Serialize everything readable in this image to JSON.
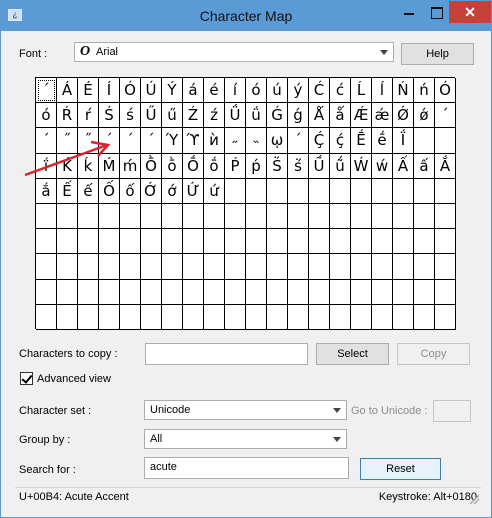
{
  "window": {
    "title": "Character Map",
    "app_icon_text": "¿",
    "close_glyph": "✕"
  },
  "font": {
    "label": "Font :",
    "icon_glyph": "O",
    "value": "Arial",
    "help_label": "Help"
  },
  "grid": {
    "rows": [
      [
        "´",
        "Á",
        "É",
        "Í",
        "Ó",
        "Ú",
        "Ý",
        "á",
        "é",
        "í",
        "ó",
        "ú",
        "ý",
        "Ć",
        "ć",
        "Ĺ",
        "ĺ",
        "Ń",
        "ń",
        "Ó"
      ],
      [
        "ó",
        "Ŕ",
        "ŕ",
        "Ś",
        "ś",
        "Ű",
        "ű",
        "Ź",
        "ź",
        "Ǘ",
        "ǘ",
        "Ǵ",
        "ǵ",
        "Ǻ",
        "ǻ",
        "Ǽ",
        "ǽ",
        "Ǿ",
        "ǿ",
        "´"
      ],
      [
        "´",
        "˝",
        "˝",
        "ˊ",
        "ˊ",
        "ˊ",
        "Ύ",
        "ϓ",
        "ѝ",
        "˶",
        "˵",
        "ῳ",
        "´",
        "Ḉ",
        "ḉ",
        "Ḗ",
        "ḗ",
        "Ḯ"
      ],
      [
        "ḯ",
        "Ḱ",
        "ḱ",
        "Ḿ",
        "ḿ",
        "Ṑ",
        "ṑ",
        "Ṓ",
        "ṓ",
        "Ṕ",
        "ṕ",
        "Ṥ",
        "ṥ",
        "Ṹ",
        "ṹ",
        "Ẃ",
        "ẃ",
        "Ấ",
        "ấ",
        "Ắ"
      ],
      [
        "ắ",
        "Ế",
        "ế",
        "Ố",
        "ố",
        "Ớ",
        "ớ",
        "Ứ",
        "ứ"
      ]
    ],
    "selected_index": 0
  },
  "copy": {
    "label": "Characters to copy :",
    "value": "",
    "select_label": "Select",
    "copy_label": "Copy"
  },
  "advanced": {
    "label": "Advanced view",
    "checked": true
  },
  "charset": {
    "label": "Character set :",
    "value": "Unicode",
    "goto_label": "Go to Unicode :",
    "goto_value": ""
  },
  "group": {
    "label": "Group by :",
    "value": "All"
  },
  "search": {
    "label": "Search for :",
    "value": "acute",
    "reset_label": "Reset"
  },
  "status": {
    "left": "U+00B4: Acute Accent",
    "right": "Keystroke: Alt+0180"
  },
  "colors": {
    "titlebar": "#5b9bd5",
    "close": "#c7413b",
    "annotation_arrow": "#e0202a"
  }
}
